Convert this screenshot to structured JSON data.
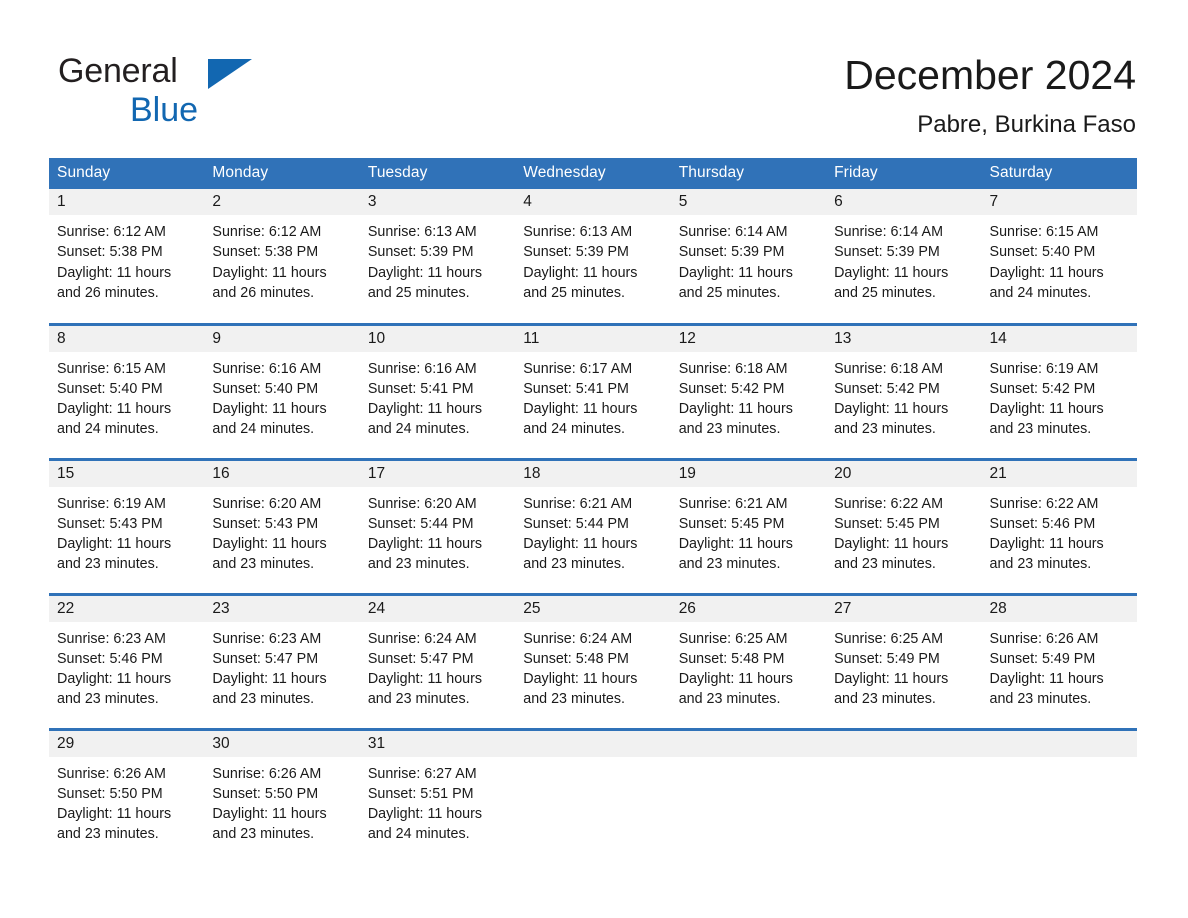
{
  "brand": {
    "line1": "General",
    "line2": "Blue",
    "triangle_color": "#1267b1"
  },
  "header": {
    "title": "December 2024",
    "subtitle": "Pabre, Burkina Faso",
    "accent_color": "#3072b8"
  },
  "weekdays": [
    "Sunday",
    "Monday",
    "Tuesday",
    "Wednesday",
    "Thursday",
    "Friday",
    "Saturday"
  ],
  "labels": {
    "sunrise": "Sunrise:",
    "sunset": "Sunset:",
    "daylight": "Daylight:"
  },
  "weeks": [
    [
      {
        "day": "1",
        "sunrise": "Sunrise: 6:12 AM",
        "sunset": "Sunset: 5:38 PM",
        "daylight_1": "Daylight: 11 hours",
        "daylight_2": "and 26 minutes."
      },
      {
        "day": "2",
        "sunrise": "Sunrise: 6:12 AM",
        "sunset": "Sunset: 5:38 PM",
        "daylight_1": "Daylight: 11 hours",
        "daylight_2": "and 26 minutes."
      },
      {
        "day": "3",
        "sunrise": "Sunrise: 6:13 AM",
        "sunset": "Sunset: 5:39 PM",
        "daylight_1": "Daylight: 11 hours",
        "daylight_2": "and 25 minutes."
      },
      {
        "day": "4",
        "sunrise": "Sunrise: 6:13 AM",
        "sunset": "Sunset: 5:39 PM",
        "daylight_1": "Daylight: 11 hours",
        "daylight_2": "and 25 minutes."
      },
      {
        "day": "5",
        "sunrise": "Sunrise: 6:14 AM",
        "sunset": "Sunset: 5:39 PM",
        "daylight_1": "Daylight: 11 hours",
        "daylight_2": "and 25 minutes."
      },
      {
        "day": "6",
        "sunrise": "Sunrise: 6:14 AM",
        "sunset": "Sunset: 5:39 PM",
        "daylight_1": "Daylight: 11 hours",
        "daylight_2": "and 25 minutes."
      },
      {
        "day": "7",
        "sunrise": "Sunrise: 6:15 AM",
        "sunset": "Sunset: 5:40 PM",
        "daylight_1": "Daylight: 11 hours",
        "daylight_2": "and 24 minutes."
      }
    ],
    [
      {
        "day": "8",
        "sunrise": "Sunrise: 6:15 AM",
        "sunset": "Sunset: 5:40 PM",
        "daylight_1": "Daylight: 11 hours",
        "daylight_2": "and 24 minutes."
      },
      {
        "day": "9",
        "sunrise": "Sunrise: 6:16 AM",
        "sunset": "Sunset: 5:40 PM",
        "daylight_1": "Daylight: 11 hours",
        "daylight_2": "and 24 minutes."
      },
      {
        "day": "10",
        "sunrise": "Sunrise: 6:16 AM",
        "sunset": "Sunset: 5:41 PM",
        "daylight_1": "Daylight: 11 hours",
        "daylight_2": "and 24 minutes."
      },
      {
        "day": "11",
        "sunrise": "Sunrise: 6:17 AM",
        "sunset": "Sunset: 5:41 PM",
        "daylight_1": "Daylight: 11 hours",
        "daylight_2": "and 24 minutes."
      },
      {
        "day": "12",
        "sunrise": "Sunrise: 6:18 AM",
        "sunset": "Sunset: 5:42 PM",
        "daylight_1": "Daylight: 11 hours",
        "daylight_2": "and 23 minutes."
      },
      {
        "day": "13",
        "sunrise": "Sunrise: 6:18 AM",
        "sunset": "Sunset: 5:42 PM",
        "daylight_1": "Daylight: 11 hours",
        "daylight_2": "and 23 minutes."
      },
      {
        "day": "14",
        "sunrise": "Sunrise: 6:19 AM",
        "sunset": "Sunset: 5:42 PM",
        "daylight_1": "Daylight: 11 hours",
        "daylight_2": "and 23 minutes."
      }
    ],
    [
      {
        "day": "15",
        "sunrise": "Sunrise: 6:19 AM",
        "sunset": "Sunset: 5:43 PM",
        "daylight_1": "Daylight: 11 hours",
        "daylight_2": "and 23 minutes."
      },
      {
        "day": "16",
        "sunrise": "Sunrise: 6:20 AM",
        "sunset": "Sunset: 5:43 PM",
        "daylight_1": "Daylight: 11 hours",
        "daylight_2": "and 23 minutes."
      },
      {
        "day": "17",
        "sunrise": "Sunrise: 6:20 AM",
        "sunset": "Sunset: 5:44 PM",
        "daylight_1": "Daylight: 11 hours",
        "daylight_2": "and 23 minutes."
      },
      {
        "day": "18",
        "sunrise": "Sunrise: 6:21 AM",
        "sunset": "Sunset: 5:44 PM",
        "daylight_1": "Daylight: 11 hours",
        "daylight_2": "and 23 minutes."
      },
      {
        "day": "19",
        "sunrise": "Sunrise: 6:21 AM",
        "sunset": "Sunset: 5:45 PM",
        "daylight_1": "Daylight: 11 hours",
        "daylight_2": "and 23 minutes."
      },
      {
        "day": "20",
        "sunrise": "Sunrise: 6:22 AM",
        "sunset": "Sunset: 5:45 PM",
        "daylight_1": "Daylight: 11 hours",
        "daylight_2": "and 23 minutes."
      },
      {
        "day": "21",
        "sunrise": "Sunrise: 6:22 AM",
        "sunset": "Sunset: 5:46 PM",
        "daylight_1": "Daylight: 11 hours",
        "daylight_2": "and 23 minutes."
      }
    ],
    [
      {
        "day": "22",
        "sunrise": "Sunrise: 6:23 AM",
        "sunset": "Sunset: 5:46 PM",
        "daylight_1": "Daylight: 11 hours",
        "daylight_2": "and 23 minutes."
      },
      {
        "day": "23",
        "sunrise": "Sunrise: 6:23 AM",
        "sunset": "Sunset: 5:47 PM",
        "daylight_1": "Daylight: 11 hours",
        "daylight_2": "and 23 minutes."
      },
      {
        "day": "24",
        "sunrise": "Sunrise: 6:24 AM",
        "sunset": "Sunset: 5:47 PM",
        "daylight_1": "Daylight: 11 hours",
        "daylight_2": "and 23 minutes."
      },
      {
        "day": "25",
        "sunrise": "Sunrise: 6:24 AM",
        "sunset": "Sunset: 5:48 PM",
        "daylight_1": "Daylight: 11 hours",
        "daylight_2": "and 23 minutes."
      },
      {
        "day": "26",
        "sunrise": "Sunrise: 6:25 AM",
        "sunset": "Sunset: 5:48 PM",
        "daylight_1": "Daylight: 11 hours",
        "daylight_2": "and 23 minutes."
      },
      {
        "day": "27",
        "sunrise": "Sunrise: 6:25 AM",
        "sunset": "Sunset: 5:49 PM",
        "daylight_1": "Daylight: 11 hours",
        "daylight_2": "and 23 minutes."
      },
      {
        "day": "28",
        "sunrise": "Sunrise: 6:26 AM",
        "sunset": "Sunset: 5:49 PM",
        "daylight_1": "Daylight: 11 hours",
        "daylight_2": "and 23 minutes."
      }
    ],
    [
      {
        "day": "29",
        "sunrise": "Sunrise: 6:26 AM",
        "sunset": "Sunset: 5:50 PM",
        "daylight_1": "Daylight: 11 hours",
        "daylight_2": "and 23 minutes."
      },
      {
        "day": "30",
        "sunrise": "Sunrise: 6:26 AM",
        "sunset": "Sunset: 5:50 PM",
        "daylight_1": "Daylight: 11 hours",
        "daylight_2": "and 23 minutes."
      },
      {
        "day": "31",
        "sunrise": "Sunrise: 6:27 AM",
        "sunset": "Sunset: 5:51 PM",
        "daylight_1": "Daylight: 11 hours",
        "daylight_2": "and 24 minutes."
      },
      {
        "day": "",
        "sunrise": "",
        "sunset": "",
        "daylight_1": "",
        "daylight_2": ""
      },
      {
        "day": "",
        "sunrise": "",
        "sunset": "",
        "daylight_1": "",
        "daylight_2": ""
      },
      {
        "day": "",
        "sunrise": "",
        "sunset": "",
        "daylight_1": "",
        "daylight_2": ""
      },
      {
        "day": "",
        "sunrise": "",
        "sunset": "",
        "daylight_1": "",
        "daylight_2": ""
      }
    ]
  ]
}
